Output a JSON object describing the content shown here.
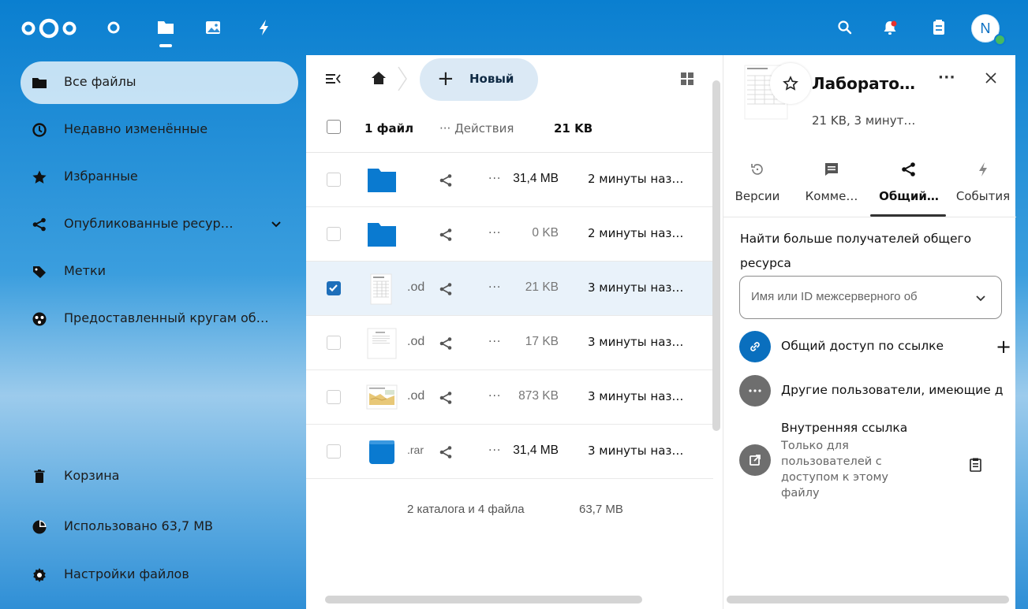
{
  "header": {
    "apps": [
      {
        "icon": "dashboard-circle-icon"
      },
      {
        "icon": "files-folder-icon",
        "active": true
      },
      {
        "icon": "photos-icon"
      },
      {
        "icon": "activity-icon"
      }
    ],
    "right": [
      "search-icon",
      "notifications-icon",
      "contacts-icon"
    ],
    "avatar_letter": "N",
    "status_color": "#46ba61"
  },
  "navigation": {
    "items": [
      {
        "label": "Все файлы",
        "icon": "folder-icon",
        "active": true
      },
      {
        "label": "Недавно изменённые",
        "icon": "clock-icon"
      },
      {
        "label": "Избранные",
        "icon": "star-icon"
      },
      {
        "label": "Опубликованные ресур…",
        "icon": "share-icon",
        "expandable": true
      },
      {
        "label": "Метки",
        "icon": "tag-icon"
      },
      {
        "label": "Предоставленный кругам об…",
        "icon": "circles-icon"
      }
    ],
    "footer": {
      "trash": "Корзина",
      "quota": "Использовано 63,7 MB",
      "quota_fraction": 0.5,
      "settings": "Настройки файлов"
    }
  },
  "files": {
    "new_button": "Новый",
    "selection": {
      "count_label": "1 файл",
      "actions_label": "Действия",
      "size": "21 KB"
    },
    "rows": [
      {
        "type": "folder",
        "ext": "",
        "size": "31,4 MB",
        "mtime": "2 минуты наз…",
        "checked": false
      },
      {
        "type": "folder",
        "ext": "",
        "size": "0 KB",
        "mtime": "2 минуты наз…",
        "checked": false
      },
      {
        "type": "spreadsheet",
        "ext": ".od",
        "size": "21 KB",
        "mtime": "3 минуты наз…",
        "checked": true
      },
      {
        "type": "document",
        "ext": ".od",
        "size": "17 KB",
        "mtime": "3 минуты наз…",
        "checked": false
      },
      {
        "type": "image-doc",
        "ext": ".od",
        "size": "873 KB",
        "mtime": "3 минуты наз…",
        "checked": false
      },
      {
        "type": "archive",
        "ext": ".rar",
        "size": "31,4 MB",
        "mtime": "3 минуты наз…",
        "checked": false
      }
    ],
    "summary_count": "2 каталога и 4 файла",
    "summary_size": "63,7 MB"
  },
  "details": {
    "title": "Лаборато…",
    "subtitle": "21 KB, 3 минут…",
    "tabs": [
      {
        "label": "Версии",
        "icon": "history-icon"
      },
      {
        "label": "Комме…",
        "icon": "comment-icon"
      },
      {
        "label": "Общий…",
        "icon": "share-icon",
        "active": true
      },
      {
        "label": "События",
        "icon": "activity-icon"
      }
    ],
    "find_label": "Найти больше получателей общего ресурса",
    "sharee_placeholder": "Имя или ID межсерверного об",
    "link_share": "Общий доступ по ссылке",
    "others": "Другие пользователи, имеющие д",
    "internal_title": "Внутренняя ссылка",
    "internal_subtitle": "Только для пользователей с доступом к этому файлу",
    "accent": "#0a6fbe"
  }
}
